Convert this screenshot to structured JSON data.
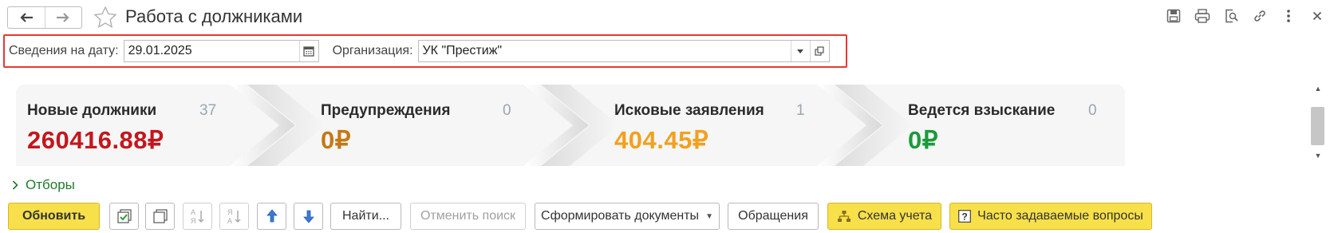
{
  "window": {
    "title": "Работа с должниками"
  },
  "filter": {
    "date_label": "Сведения на дату:",
    "date_value": "29.01.2025",
    "org_label": "Организация:",
    "org_value": "УК \"Престиж\""
  },
  "stages": [
    {
      "label": "Новые должники",
      "count": "37",
      "sum": "260416.88₽",
      "color": "#c3161c"
    },
    {
      "label": "Предупреждения",
      "count": "0",
      "sum": "0₽",
      "color": "#c77714"
    },
    {
      "label": "Исковые заявления",
      "count": "1",
      "sum": "404.45₽",
      "color": "#f2a01f"
    },
    {
      "label": "Ведется взыскание",
      "count": "0",
      "sum": "0₽",
      "color": "#1a9a3a"
    }
  ],
  "filters_link": {
    "label": "Отборы"
  },
  "toolbar": {
    "refresh": "Обновить",
    "find": "Найти...",
    "cancel_search": "Отменить поиск",
    "create_docs": "Сформировать документы",
    "appeals": "Обращения",
    "scheme": "Схема учета",
    "faq": "Часто задаваемые вопросы"
  },
  "icons": {
    "back": "arrow-left-icon",
    "forward": "arrow-right-icon",
    "favorite": "star-icon",
    "save": "floppy-icon",
    "print": "printer-icon",
    "preview": "magnifier-doc-icon",
    "link": "link-icon",
    "more": "kebab-icon",
    "close": "close-icon",
    "calendar": "calendar-icon",
    "open": "open-window-icon"
  }
}
